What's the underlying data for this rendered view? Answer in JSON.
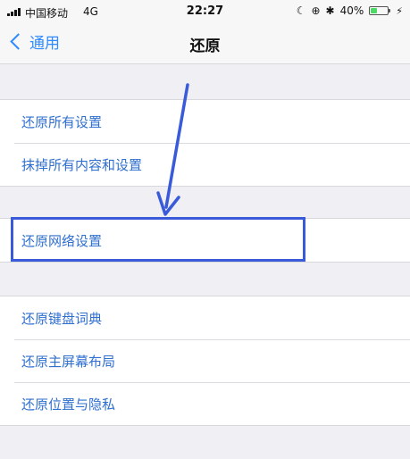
{
  "status_bar": {
    "carrier": "中国移动",
    "network": "4G",
    "time": "22:27",
    "moon_icon": "☾",
    "lock_icon": "⊕",
    "bluetooth_icon": "✱",
    "battery_percent": "40%",
    "battery_level": 0.4,
    "charge_icon": "⚡"
  },
  "nav": {
    "back_label": "通用",
    "title": "还原"
  },
  "groups": [
    {
      "items": [
        "还原所有设置",
        "抹掉所有内容和设置"
      ]
    },
    {
      "items": [
        "还原网络设置"
      ]
    },
    {
      "items": [
        "还原键盘词典",
        "还原主屏幕布局",
        "还原位置与隐私"
      ]
    }
  ],
  "colors": {
    "link": "#2f6fcf",
    "accent": "#2f8bff",
    "annotation": "#3a5bd9"
  }
}
